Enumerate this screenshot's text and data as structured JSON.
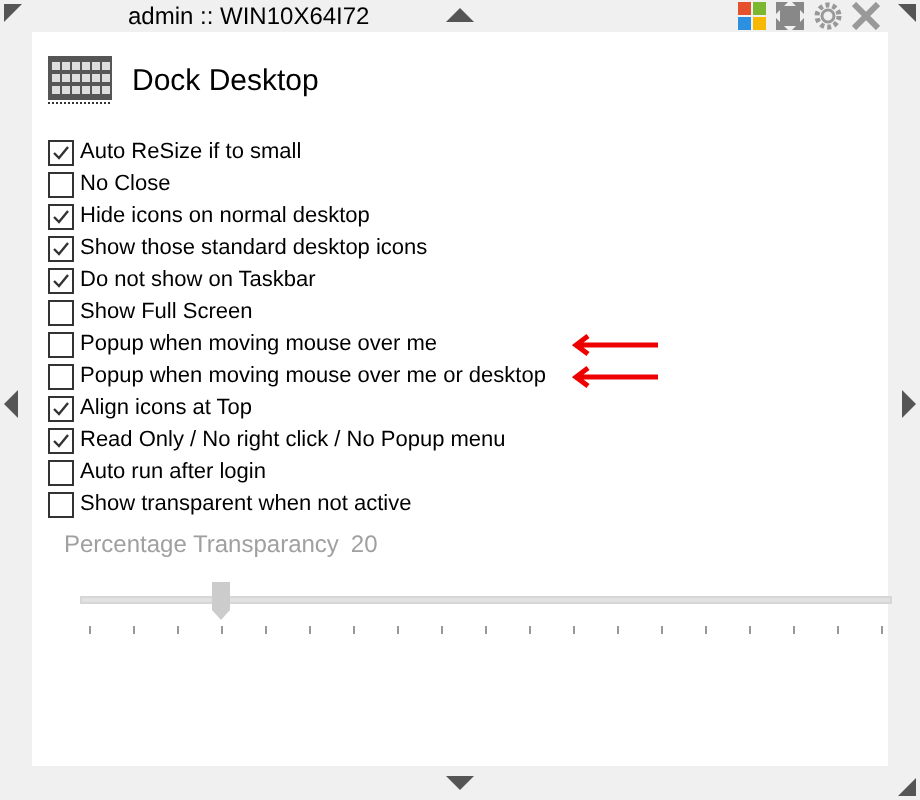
{
  "window": {
    "title": "admin :: WIN10X64I72"
  },
  "app": {
    "title": "Dock Desktop"
  },
  "options": [
    {
      "label": "Auto ReSize if to small",
      "checked": true,
      "pointed": false
    },
    {
      "label": "No Close",
      "checked": false,
      "pointed": false
    },
    {
      "label": "Hide icons on normal desktop",
      "checked": true,
      "pointed": false
    },
    {
      "label": "Show those standard desktop icons",
      "checked": true,
      "pointed": false
    },
    {
      "label": "Do not show on Taskbar",
      "checked": true,
      "pointed": false
    },
    {
      "label": "Show Full Screen",
      "checked": false,
      "pointed": false
    },
    {
      "label": "Popup when moving mouse over me",
      "checked": false,
      "pointed": true
    },
    {
      "label": "Popup when moving mouse over me or desktop",
      "checked": false,
      "pointed": true
    },
    {
      "label": "Align icons at Top",
      "checked": true,
      "pointed": false
    },
    {
      "label": "Read Only / No right click / No Popup menu",
      "checked": true,
      "pointed": false
    },
    {
      "label": "Auto run after login",
      "checked": false,
      "pointed": false
    },
    {
      "label": "Show transparent when not active",
      "checked": false,
      "pointed": false
    }
  ],
  "transparency": {
    "label": "Percentage Transparancy",
    "reading": "20",
    "level": 0.167,
    "disabled": true
  }
}
